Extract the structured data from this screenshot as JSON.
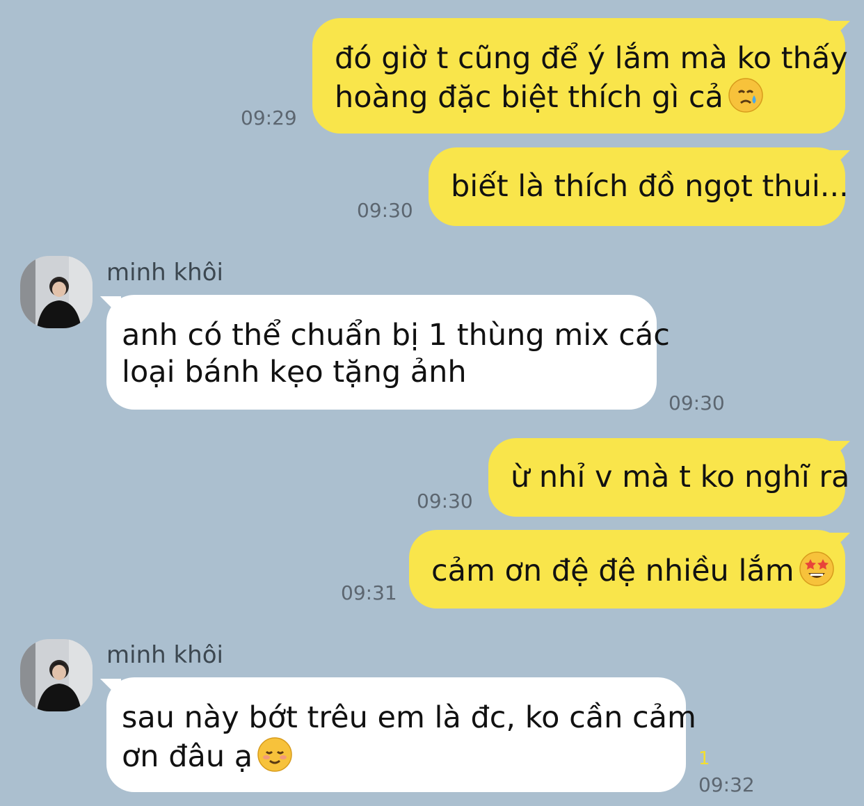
{
  "colors": {
    "background": "#abbfcf",
    "my_bubble": "#f9e54b",
    "their_bubble": "#ffffff",
    "unread": "#f4df2e"
  },
  "messages": [
    {
      "from": "me",
      "lines": [
        "đó giờ t cũng để ý lắm mà ko thấy",
        "hoàng đặc biệt thích gì cả"
      ],
      "emoji": "sad-tear-smile-emoji",
      "time": "09:29"
    },
    {
      "from": "me",
      "lines": [
        "biết là thích đồ ngọt thui..."
      ],
      "time": "09:30"
    },
    {
      "from": "them",
      "sender": "minh khôi",
      "lines": [
        "anh có thể chuẩn bị 1 thùng mix các",
        "loại bánh kẹo tặng ảnh"
      ],
      "time": "09:30"
    },
    {
      "from": "me",
      "lines": [
        "ừ nhỉ v mà t ko nghĩ ra"
      ],
      "time": "09:30"
    },
    {
      "from": "me",
      "lines": [
        "cảm ơn đệ đệ nhiều lắm"
      ],
      "emoji": "star-struck-emoji",
      "time": "09:31"
    },
    {
      "from": "them",
      "sender": "minh khôi",
      "lines": [
        "sau này bớt trêu em là đc, ko cần cảm",
        "ơn đâu ạ"
      ],
      "emoji": "smiling-blush-emoji",
      "time": "09:32",
      "unread": "1"
    }
  ]
}
